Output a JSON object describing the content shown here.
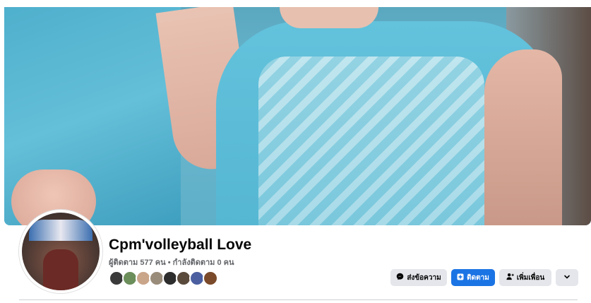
{
  "profile": {
    "name": "Cpm'volleyball Love",
    "followers_line": "ผู้ติดตาม 577 คน • กำลังติดตาม 0 คน"
  },
  "friends": [
    {
      "color": "#3a3a3a"
    },
    {
      "color": "#6b8e5a"
    },
    {
      "color": "#c9a58a"
    },
    {
      "color": "#9a8c7a"
    },
    {
      "color": "#2d2d2d"
    },
    {
      "color": "#5a4a3c"
    },
    {
      "color": "#4b5fa0"
    },
    {
      "color": "#7a4a2a"
    }
  ],
  "actions": {
    "message_label": "ส่งข้อความ",
    "message_icon": "messenger-icon",
    "follow_label": "ติดตาม",
    "follow_icon": "follow-icon",
    "add_friend_label": "เพิ่มเพื่อน",
    "add_friend_icon": "add-friend-icon",
    "more_icon": "chevron-down-icon"
  },
  "colors": {
    "accent": "#1b74e4",
    "button_grey": "#e4e6eb",
    "text_primary": "#050505",
    "text_secondary": "#65676b"
  }
}
